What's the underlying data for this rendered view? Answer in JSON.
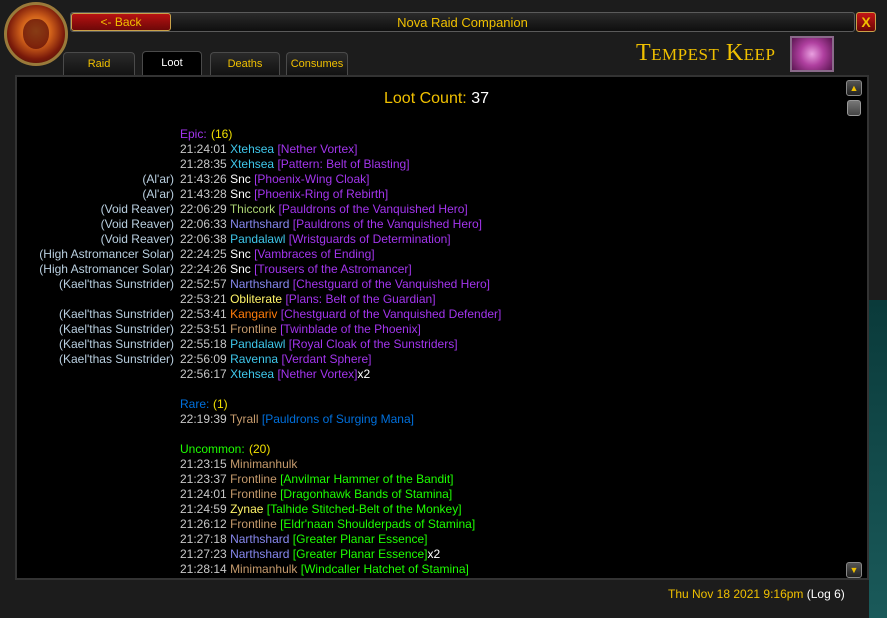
{
  "window": {
    "title": "Nova Raid Companion",
    "back_label": "<- Back",
    "close_label": "X",
    "raid_name": "Tempest Keep"
  },
  "tabs": [
    {
      "label": "Raid",
      "active": false
    },
    {
      "label": "Loot",
      "active": true
    },
    {
      "label": "Deaths",
      "active": false
    },
    {
      "label": "Consumes",
      "active": false
    }
  ],
  "loot_count": {
    "label": "Loot Count:",
    "value": "37"
  },
  "colors": {
    "epic": "#a335ee",
    "rare": "#0070dd",
    "uncommon": "#1eff00",
    "mage": "#3fc7eb",
    "paladin": "#f48cba",
    "warlock": "#8788ee",
    "priest": "#ffffff",
    "druid": "#ff7c0a",
    "warrior": "#c69b6d",
    "rogue": "#fff468",
    "hunter": "#aad372",
    "shaman": "#0070dd"
  },
  "sections": [
    {
      "header": "Epic:",
      "count": "(16)",
      "color": "#a335ee",
      "items": [
        {
          "boss": "",
          "time": "21:24:01",
          "player": "Xtehsea",
          "pcolor": "#3fc7eb",
          "item": "[Nether Vortex]",
          "extra": ""
        },
        {
          "boss": "",
          "time": "21:28:35",
          "player": "Xtehsea",
          "pcolor": "#3fc7eb",
          "item": "[Pattern: Belt of Blasting]",
          "extra": ""
        },
        {
          "boss": "(Al'ar)",
          "time": "21:43:26",
          "player": "Snc",
          "pcolor": "#ffffff",
          "item": "[Phoenix-Wing Cloak]",
          "extra": ""
        },
        {
          "boss": "(Al'ar)",
          "time": "21:43:28",
          "player": "Snc",
          "pcolor": "#ffffff",
          "item": "[Phoenix-Ring of Rebirth]",
          "extra": ""
        },
        {
          "boss": "(Void Reaver)",
          "time": "22:06:29",
          "player": "Thiccork",
          "pcolor": "#aad372",
          "item": "[Pauldrons of the Vanquished Hero]",
          "extra": ""
        },
        {
          "boss": "(Void Reaver)",
          "time": "22:06:33",
          "player": "Narthshard",
          "pcolor": "#8788ee",
          "item": "[Pauldrons of the Vanquished Hero]",
          "extra": ""
        },
        {
          "boss": "(Void Reaver)",
          "time": "22:06:38",
          "player": "Pandalawl",
          "pcolor": "#3fc7eb",
          "item": "[Wristguards of Determination]",
          "extra": ""
        },
        {
          "boss": "(High Astromancer Solar)",
          "time": "22:24:25",
          "player": "Snc",
          "pcolor": "#ffffff",
          "item": "[Vambraces of Ending]",
          "extra": ""
        },
        {
          "boss": "(High Astromancer Solar)",
          "time": "22:24:26",
          "player": "Snc",
          "pcolor": "#ffffff",
          "item": "[Trousers of the Astromancer]",
          "extra": ""
        },
        {
          "boss": "(Kael'thas Sunstrider)",
          "time": "22:52:57",
          "player": "Narthshard",
          "pcolor": "#8788ee",
          "item": "[Chestguard of the Vanquished Hero]",
          "extra": ""
        },
        {
          "boss": "",
          "time": "22:53:21",
          "player": "Obliterate",
          "pcolor": "#fff468",
          "item": "[Plans: Belt of the Guardian]",
          "extra": ""
        },
        {
          "boss": "(Kael'thas Sunstrider)",
          "time": "22:53:41",
          "player": "Kangariv",
          "pcolor": "#ff7c0a",
          "item": "[Chestguard of the Vanquished Defender]",
          "extra": ""
        },
        {
          "boss": "(Kael'thas Sunstrider)",
          "time": "22:53:51",
          "player": "Frontline",
          "pcolor": "#c69b6d",
          "item": "[Twinblade of the Phoenix]",
          "extra": ""
        },
        {
          "boss": "(Kael'thas Sunstrider)",
          "time": "22:55:18",
          "player": "Pandalawl",
          "pcolor": "#3fc7eb",
          "item": "[Royal Cloak of the Sunstriders]",
          "extra": ""
        },
        {
          "boss": "(Kael'thas Sunstrider)",
          "time": "22:56:09",
          "player": "Ravenna",
          "pcolor": "#3fc7eb",
          "item": "[Verdant Sphere]",
          "extra": ""
        },
        {
          "boss": "",
          "time": "22:56:17",
          "player": "Xtehsea",
          "pcolor": "#3fc7eb",
          "item": "[Nether Vortex]",
          "extra": "x2"
        }
      ]
    },
    {
      "header": "Rare:",
      "count": "(1)",
      "color": "#0070dd",
      "items": [
        {
          "boss": "",
          "time": "22:19:39",
          "player": "Tyrall",
          "pcolor": "#c69b6d",
          "item": "[Pauldrons of Surging Mana]",
          "extra": ""
        }
      ]
    },
    {
      "header": "Uncommon:",
      "count": "(20)",
      "color": "#1eff00",
      "items": [
        {
          "boss": "",
          "time": "21:23:15",
          "player": "Minimanhulk",
          "pcolor": "#c69b6d",
          "item": "",
          "extra": ""
        },
        {
          "boss": "",
          "time": "21:23:37",
          "player": "Frontline",
          "pcolor": "#c69b6d",
          "item": "[Anvilmar Hammer of the Bandit]",
          "extra": ""
        },
        {
          "boss": "",
          "time": "21:24:01",
          "player": "Frontline",
          "pcolor": "#c69b6d",
          "item": "[Dragonhawk Bands of Stamina]",
          "extra": ""
        },
        {
          "boss": "",
          "time": "21:24:59",
          "player": "Zynae",
          "pcolor": "#fff468",
          "item": "[Talhide Stitched-Belt of the Monkey]",
          "extra": ""
        },
        {
          "boss": "",
          "time": "21:26:12",
          "player": "Frontline",
          "pcolor": "#c69b6d",
          "item": "[Eldr'naan Shoulderpads of Stamina]",
          "extra": ""
        },
        {
          "boss": "",
          "time": "21:27:18",
          "player": "Narthshard",
          "pcolor": "#8788ee",
          "item": "[Greater Planar Essence]",
          "extra": ""
        },
        {
          "boss": "",
          "time": "21:27:23",
          "player": "Narthshard",
          "pcolor": "#8788ee",
          "item": "[Greater Planar Essence]",
          "extra": "x2"
        },
        {
          "boss": "",
          "time": "21:28:14",
          "player": "Minimanhulk",
          "pcolor": "#c69b6d",
          "item": "[Windcaller Hatchet of Stamina]",
          "extra": ""
        }
      ]
    }
  ],
  "footer": {
    "date": "Thu Nov 18 2021 9:16pm",
    "log": "(Log 6)"
  }
}
